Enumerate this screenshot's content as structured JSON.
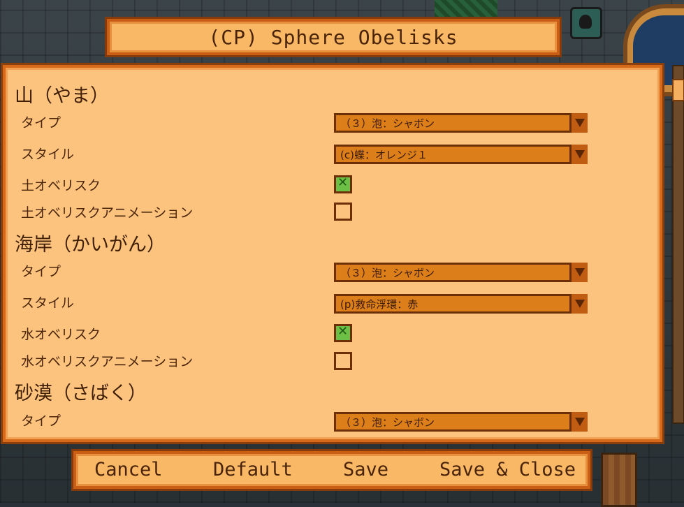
{
  "title": "(CP) Sphere Obelisks",
  "sections": [
    {
      "title": "山（やま）",
      "type_label": "タイプ",
      "type_value": "（３）泡：シャボン",
      "style_label": "スタイル",
      "style_value": "(c)蝶：オレンジ１",
      "obelisk_label": "土オベリスク",
      "obelisk_checked": true,
      "animation_label": "土オベリスクアニメーション",
      "animation_checked": false
    },
    {
      "title": "海岸（かいがん）",
      "type_label": "タイプ",
      "type_value": "（３）泡：シャボン",
      "style_label": "スタイル",
      "style_value": "(p)救命浮環：赤",
      "obelisk_label": "水オベリスク",
      "obelisk_checked": true,
      "animation_label": "水オベリスクアニメーション",
      "animation_checked": false
    },
    {
      "title": "砂漠（さばく）",
      "type_label": "タイプ",
      "type_value": "（３）泡：シャボン"
    }
  ],
  "buttons": {
    "cancel": "Cancel",
    "default": "Default",
    "save": "Save",
    "save_close": "Save & Close"
  },
  "icons": {
    "checkmark": "✕"
  },
  "colors": {
    "panel_bg": "#fcc37f",
    "panel_border": "#d66a1a",
    "dropdown_bg": "#dc7f1a",
    "checked_bg": "#6cc046"
  }
}
